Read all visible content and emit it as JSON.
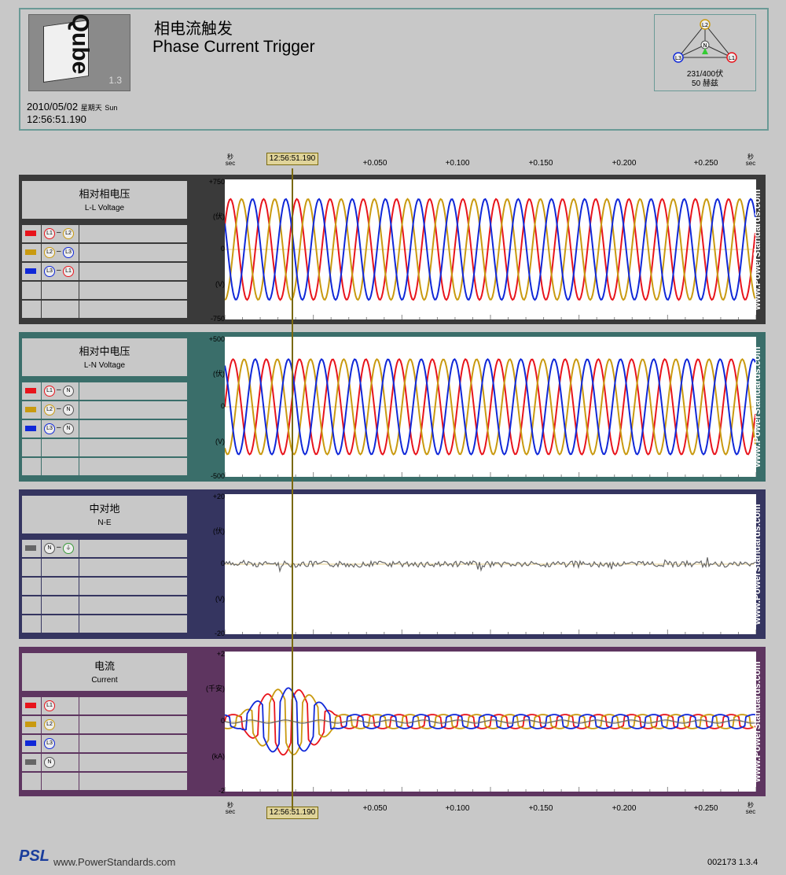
{
  "header": {
    "title_cn": "相电流触发",
    "title_en": "Phase Current Trigger",
    "logo_version": "1.3",
    "logo_text": "Qube",
    "date": "2010/05/02",
    "weekday_cn": "星期天",
    "weekday_en": "Sun",
    "time": "12:56:51.190",
    "phase_labels": [
      "L2",
      "N",
      "L3",
      "L1"
    ],
    "rating_line1": "231/400伏",
    "rating_line2": "50 赫兹"
  },
  "axis": {
    "cursor_time": "12:56:51.190",
    "ticks": [
      "+0.050",
      "+0.100",
      "+0.150",
      "+0.200",
      "+0.250"
    ],
    "sec_cn": "秒",
    "sec_en": "sec"
  },
  "colors": {
    "L1": "#e8141c",
    "L2": "#c99a10",
    "L3": "#1028d8",
    "N": "#666666"
  },
  "panels": [
    {
      "title_cn": "相对相电压",
      "title_en": "L-L Voltage",
      "frame_color": "#3a3a3a",
      "y_top": "+750",
      "y_mid": "0",
      "y_bot": "-750",
      "unit_cn": "(伏)",
      "unit_en": "(V)",
      "rows": [
        {
          "color": "#e8141c",
          "a": "L1",
          "b": "L2"
        },
        {
          "color": "#c99a10",
          "a": "L2",
          "b": "L3"
        },
        {
          "color": "#1028d8",
          "a": "L3",
          "b": "L1"
        }
      ]
    },
    {
      "title_cn": "相对中电压",
      "title_en": "L-N Voltage",
      "frame_color": "#3a6e6a",
      "y_top": "+500",
      "y_mid": "0",
      "y_bot": "-500",
      "unit_cn": "(伏)",
      "unit_en": "(V)",
      "rows": [
        {
          "color": "#e8141c",
          "a": "L1",
          "b": "N"
        },
        {
          "color": "#c99a10",
          "a": "L2",
          "b": "N"
        },
        {
          "color": "#1028d8",
          "a": "L3",
          "b": "N"
        }
      ]
    },
    {
      "title_cn": "中对地",
      "title_en": "N-E",
      "frame_color": "#353560",
      "y_top": "+20",
      "y_mid": "0",
      "y_bot": "-20",
      "unit_cn": "(伏)",
      "unit_en": "(V)",
      "rows": [
        {
          "color": "#666666",
          "a": "N",
          "b": "⏚"
        }
      ]
    },
    {
      "title_cn": "电流",
      "title_en": "Current",
      "frame_color": "#5e3560",
      "y_top": "+2",
      "y_mid": "0",
      "y_bot": "-2",
      "unit_cn": "(千安)",
      "unit_en": "(kA)",
      "rows": [
        {
          "color": "#e8141c",
          "a": "L1",
          "b": ""
        },
        {
          "color": "#c99a10",
          "a": "L2",
          "b": ""
        },
        {
          "color": "#1028d8",
          "a": "L3",
          "b": ""
        },
        {
          "color": "#666666",
          "a": "N",
          "b": ""
        }
      ]
    }
  ],
  "watermark": "www.PowerStandards.com",
  "footer": {
    "logo": "PSL",
    "url": "www.PowerStandards.com",
    "version": "002173  1.3.4"
  }
}
